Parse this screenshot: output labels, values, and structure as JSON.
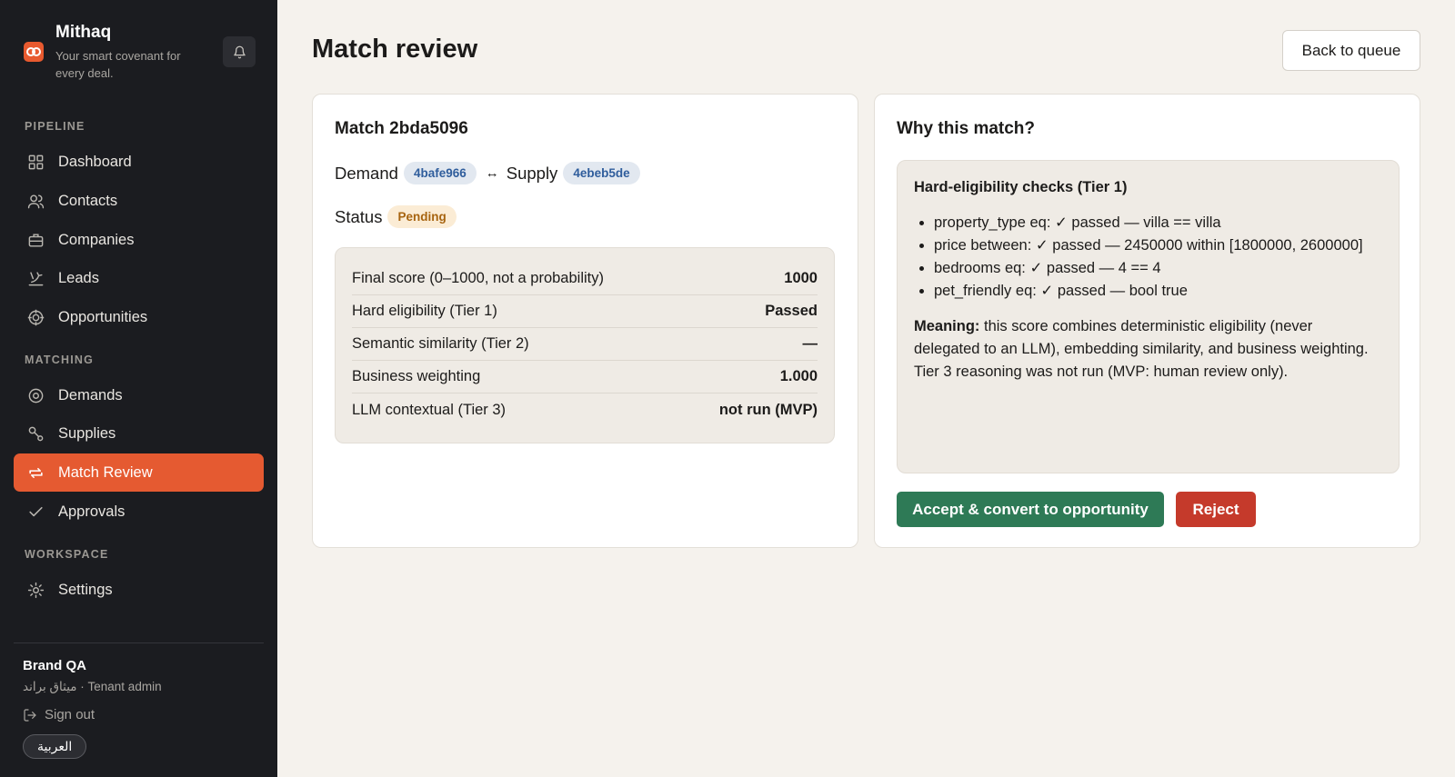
{
  "brand": {
    "name": "Mithaq",
    "tagline": "Your smart covenant for every deal."
  },
  "sidebar": {
    "sections": {
      "pipeline": "PIPELINE",
      "matching": "MATCHING",
      "workspace": "WORKSPACE"
    },
    "items": [
      {
        "label": "Dashboard",
        "icon": "grid-icon"
      },
      {
        "label": "Contacts",
        "icon": "users-icon"
      },
      {
        "label": "Companies",
        "icon": "briefcase-icon"
      },
      {
        "label": "Leads",
        "icon": "leads-icon"
      },
      {
        "label": "Opportunities",
        "icon": "target-icon"
      },
      {
        "label": "Demands",
        "icon": "demand-icon"
      },
      {
        "label": "Supplies",
        "icon": "supply-icon"
      },
      {
        "label": "Match Review",
        "icon": "match-icon",
        "active": true
      },
      {
        "label": "Approvals",
        "icon": "check-icon"
      },
      {
        "label": "Settings",
        "icon": "gear-icon"
      }
    ]
  },
  "user": {
    "name": "Brand QA",
    "role": "ميثاق براند · Tenant admin",
    "signout": "Sign out",
    "language": "العربية"
  },
  "page": {
    "title": "Match review",
    "back_label": "Back to queue"
  },
  "match": {
    "title": "Match 2bda5096",
    "demand_label": "Demand",
    "demand_id": "4bafe966",
    "arrow": "↔",
    "supply_label": "Supply",
    "supply_id": "4ebeb5de",
    "status_label": "Status",
    "status_value": "Pending",
    "scores": [
      {
        "label": "Final score (0–1000, not a probability)",
        "value": "1000"
      },
      {
        "label": "Hard eligibility (Tier 1)",
        "value": "Passed"
      },
      {
        "label": "Semantic similarity (Tier 2)",
        "value": "—"
      },
      {
        "label": "Business weighting",
        "value": "1.000"
      },
      {
        "label": "LLM contextual (Tier 3)",
        "value": "not run (MVP)"
      }
    ]
  },
  "why": {
    "title": "Why this match?",
    "checks_title": "Hard-eligibility checks (Tier 1)",
    "checks": [
      "property_type eq: ✓ passed — villa == villa",
      "price between: ✓ passed — 2450000 within [1800000, 2600000]",
      "bedrooms eq: ✓ passed — 4 == 4",
      "pet_friendly eq: ✓ passed — bool true"
    ],
    "meaning_label": "Meaning:",
    "meaning_text": " this score combines deterministic eligibility (never delegated to an LLM), embedding similarity, and business weighting. Tier 3 reasoning was not run (MVP: human review only).",
    "accept_label": "Accept & convert to opportunity",
    "reject_label": "Reject"
  },
  "colors": {
    "accent": "#e55a31",
    "sidebar_bg": "#1b1c20",
    "accept": "#2e7a56",
    "reject": "#c53a2b",
    "pending": "#a76410"
  }
}
